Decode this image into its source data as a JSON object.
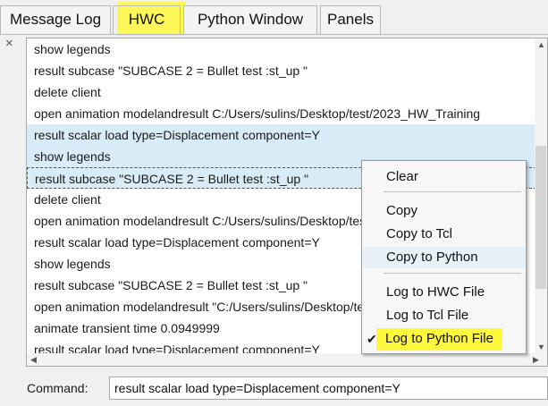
{
  "tabs": [
    {
      "label": "Message Log"
    },
    {
      "label": "HWC"
    },
    {
      "label": "Python Window"
    },
    {
      "label": "Panels"
    }
  ],
  "close_glyph": "×",
  "log_lines": [
    {
      "text": "show legends"
    },
    {
      "text": "result subcase \"SUBCASE 2 = Bullet test :st_up \""
    },
    {
      "text": "delete client"
    },
    {
      "text": "open animation modelandresult C:/Users/sulins/Desktop/test/2023_HW_Training"
    },
    {
      "text": "result scalar load type=Displacement component=Y"
    },
    {
      "text": "show legends"
    },
    {
      "text": "result subcase \"SUBCASE 2 = Bullet test :st_up \""
    },
    {
      "text": "delete client"
    },
    {
      "text": "open animation modelandresult C:/Users/sulins/Desktop/test/2023_HW_Training"
    },
    {
      "text": "result scalar load type=Displacement component=Y"
    },
    {
      "text": "show legends"
    },
    {
      "text": "result subcase \"SUBCASE 2 = Bullet test :st_up \""
    },
    {
      "text": "open animation modelandresult \"C:/Users/sulins/Desktop/test/2023_HW_Trainini"
    },
    {
      "text": "animate transient time 0.0949999"
    },
    {
      "text": "result scalar load type=Displacement component=Y"
    }
  ],
  "context_menu": {
    "clear": "Clear",
    "copy": "Copy",
    "copy_tcl": "Copy to Tcl",
    "copy_python": "Copy to Python",
    "log_hwc": "Log to HWC File",
    "log_tcl": "Log to Tcl File",
    "log_python": "Log to Python File",
    "check_glyph": "✔"
  },
  "command": {
    "label": "Command:",
    "value": "result scalar load type=Displacement component=Y"
  },
  "scroll_glyphs": {
    "up": "▲",
    "down": "▼",
    "left": "◀",
    "right": "▶"
  },
  "colors": {
    "highlight": "#fff83d",
    "selection": "#d8ecf7"
  }
}
